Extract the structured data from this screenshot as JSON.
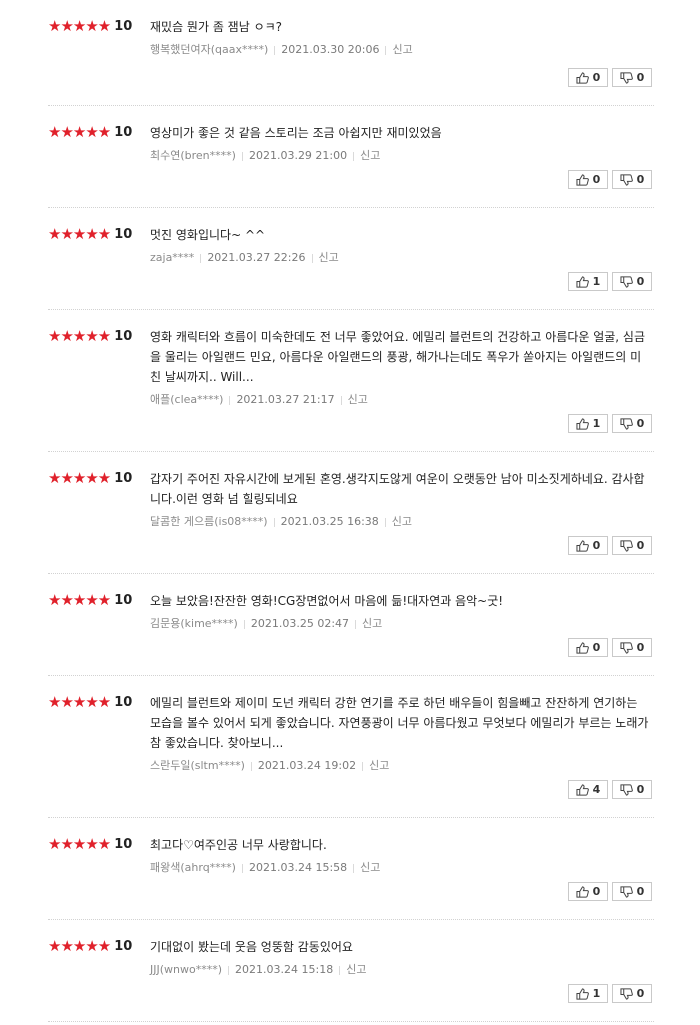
{
  "reviews": [
    {
      "stars": "★★★★★",
      "score": "10",
      "text": "재밌슴 뭔가 좀 잼남 ㅇㅋ?",
      "author": "행복했던여자(qaax****)",
      "date": "2021.03.30 20:06",
      "report": "신고",
      "like": "0",
      "dislike": "0"
    },
    {
      "stars": "★★★★★",
      "score": "10",
      "text": "영상미가 좋은 것 같음 스토리는 조금 아쉽지만 재미있었음",
      "author": "최수연(bren****)",
      "date": "2021.03.29 21:00",
      "report": "신고",
      "like": "0",
      "dislike": "0"
    },
    {
      "stars": "★★★★★",
      "score": "10",
      "text": "멋진 영화입니다~ ^^",
      "author": "zaja****",
      "date": "2021.03.27 22:26",
      "report": "신고",
      "like": "1",
      "dislike": "0"
    },
    {
      "stars": "★★★★★",
      "score": "10",
      "text": "영화 캐릭터와 흐름이 미숙한데도 전 너무 좋았어요. 에밀리 블런트의 건강하고 아름다운 얼굴, 심금을 울리는 아일랜드 민요, 아름다운 아일랜드의 풍광, 해가나는데도 폭우가 쏟아지는 아일랜드의 미친 날씨까지.. Will...",
      "author": "애플(clea****)",
      "date": "2021.03.27 21:17",
      "report": "신고",
      "like": "1",
      "dislike": "0"
    },
    {
      "stars": "★★★★★",
      "score": "10",
      "text": "갑자기 주어진 자유시간에 보게된 혼영.생각지도않게 여운이 오랫동안 남아 미소짓게하네요. 감사합니다.이런 영화 넘 힐링되네요",
      "author": "달콤한 게으름(is08****)",
      "date": "2021.03.25 16:38",
      "report": "신고",
      "like": "0",
      "dislike": "0"
    },
    {
      "stars": "★★★★★",
      "score": "10",
      "text": "오늘 보았음!잔잔한 영화!CG장면없어서 마음에 듦!대자연과 음악~굿!",
      "author": "김문용(kime****)",
      "date": "2021.03.25 02:47",
      "report": "신고",
      "like": "0",
      "dislike": "0"
    },
    {
      "stars": "★★★★★",
      "score": "10",
      "text": "에밀리 블런트와 제이미 도넌 캐릭터 강한 연기를 주로 하던 배우들이 힘을빼고 잔잔하게 연기하는 모습을 볼수 있어서 되게 좋았습니다. 자연풍광이 너무 아름다웠고 무엇보다 에밀리가 부르는 노래가 참 좋았습니다. 찾아보니...",
      "author": "스란두일(sltm****)",
      "date": "2021.03.24 19:02",
      "report": "신고",
      "like": "4",
      "dislike": "0"
    },
    {
      "stars": "★★★★★",
      "score": "10",
      "text": "최고다♡여주인공 너무 사랑합니다.",
      "author": "패왕색(ahrq****)",
      "date": "2021.03.24 15:58",
      "report": "신고",
      "like": "0",
      "dislike": "0"
    },
    {
      "stars": "★★★★★",
      "score": "10",
      "text": "기대없이 봤는데 웃음 엉뚱함 감동있어요",
      "author": "JJJ(wnwo****)",
      "date": "2021.03.24 15:18",
      "report": "신고",
      "like": "1",
      "dislike": "0"
    }
  ]
}
